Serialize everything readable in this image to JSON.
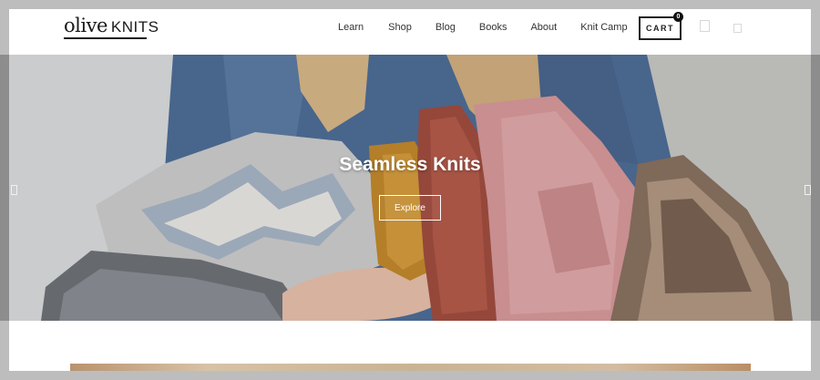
{
  "brand": {
    "script": "olive",
    "word": "KNITS"
  },
  "nav": {
    "items": [
      {
        "label": "Learn"
      },
      {
        "label": "Shop"
      },
      {
        "label": "Blog"
      },
      {
        "label": "Books"
      },
      {
        "label": "About"
      },
      {
        "label": "Knit Camp"
      }
    ]
  },
  "cart": {
    "label": "CART",
    "count": "0"
  },
  "header_icons": [
    "account-icon",
    "search-icon"
  ],
  "hero": {
    "title": "Seamless Knits",
    "button_label": "Explore"
  },
  "colors": {
    "page_bg": "#ffffff",
    "frame": "#bdbdbd",
    "text": "#333333",
    "hero_text": "#ffffff"
  }
}
